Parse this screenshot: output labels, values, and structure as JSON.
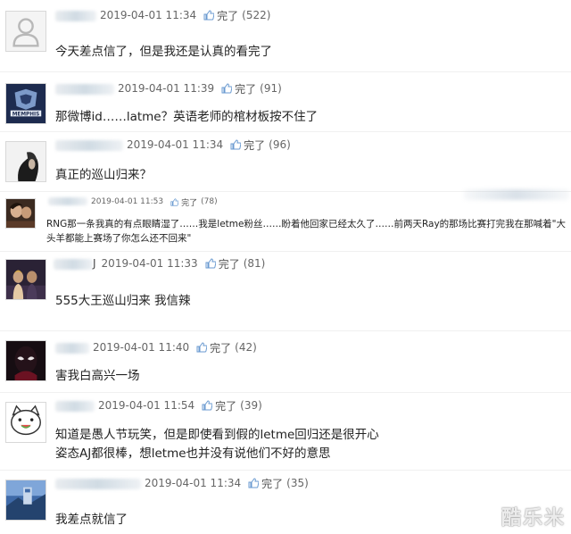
{
  "like_label": "完了",
  "watermark": "酷乐米",
  "comments": [
    {
      "user_visible": "",
      "date": "2019-04-01 11:34",
      "likes": "(522)",
      "text": "今天差点信了，但是我还是认真的看完了",
      "avatar_icon": "default-person-icon"
    },
    {
      "user_visible": "",
      "date": "2019-04-01 11:39",
      "likes": "(91)",
      "text": "那微博id……latme？英语老师的棺材板按不住了",
      "avatar_icon": "memphis-logo-icon"
    },
    {
      "user_visible": "",
      "date": "2019-04-01 11:34",
      "likes": "(96)",
      "text": "真正的巡山归来？",
      "avatar_icon": "dark-portrait-icon"
    },
    {
      "user_visible": "",
      "date": "2019-04-01 11:53",
      "likes": "(78)",
      "text": "RNG那一条我真的有点眼睛湿了……我是letme粉丝……盼着他回家已经太久了……前两天Ray的那场比赛打完我在那喊着\"大头羊都能上赛场了你怎么还不回来\"",
      "avatar_icon": "photo-avatar-icon"
    },
    {
      "user_visible": "J",
      "date": "2019-04-01 11:33",
      "likes": "(81)",
      "text": "555大王巡山归来 我信辣",
      "avatar_icon": "stage-photo-icon"
    },
    {
      "user_visible": "",
      "date": "2019-04-01 11:40",
      "likes": "(42)",
      "text": "害我白高兴一场",
      "avatar_icon": "spider-hero-icon"
    },
    {
      "user_visible": "",
      "date": "2019-04-01 11:54",
      "likes": "(39)",
      "text": "知道是愚人节玩笑，但是即使看到假的letme回归还是很开心",
      "text2": "姿态AJ都很棒，想letme也并没有说他们不好的意思",
      "avatar_icon": "cartoon-cat-icon"
    },
    {
      "user_visible": "",
      "date": "2019-04-01 11:34",
      "likes": "(35)",
      "text": "我差点就信了",
      "avatar_icon": "blue-photo-icon"
    }
  ]
}
